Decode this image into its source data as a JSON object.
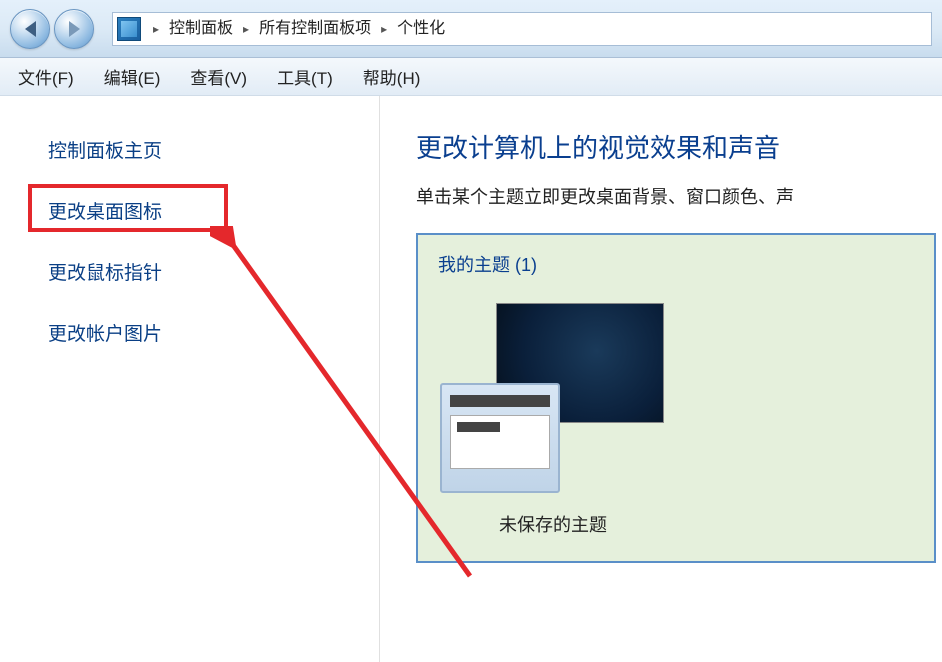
{
  "breadcrumb": {
    "items": [
      "控制面板",
      "所有控制面板项",
      "个性化"
    ]
  },
  "menu": {
    "file": "文件(F)",
    "edit": "编辑(E)",
    "view": "查看(V)",
    "tools": "工具(T)",
    "help": "帮助(H)"
  },
  "sidebar": {
    "home": "控制面板主页",
    "change_desktop_icons": "更改桌面图标",
    "change_mouse_pointer": "更改鼠标指针",
    "change_account_picture": "更改帐户图片"
  },
  "main": {
    "title": "更改计算机上的视觉效果和声音",
    "subtitle": "单击某个主题立即更改桌面背景、窗口颜色、声",
    "my_themes_header": "我的主题 (1)",
    "theme1_label": "未保存的主题"
  },
  "icons": {
    "back": "back-arrow",
    "forward": "forward-arrow",
    "sep": "▸"
  }
}
